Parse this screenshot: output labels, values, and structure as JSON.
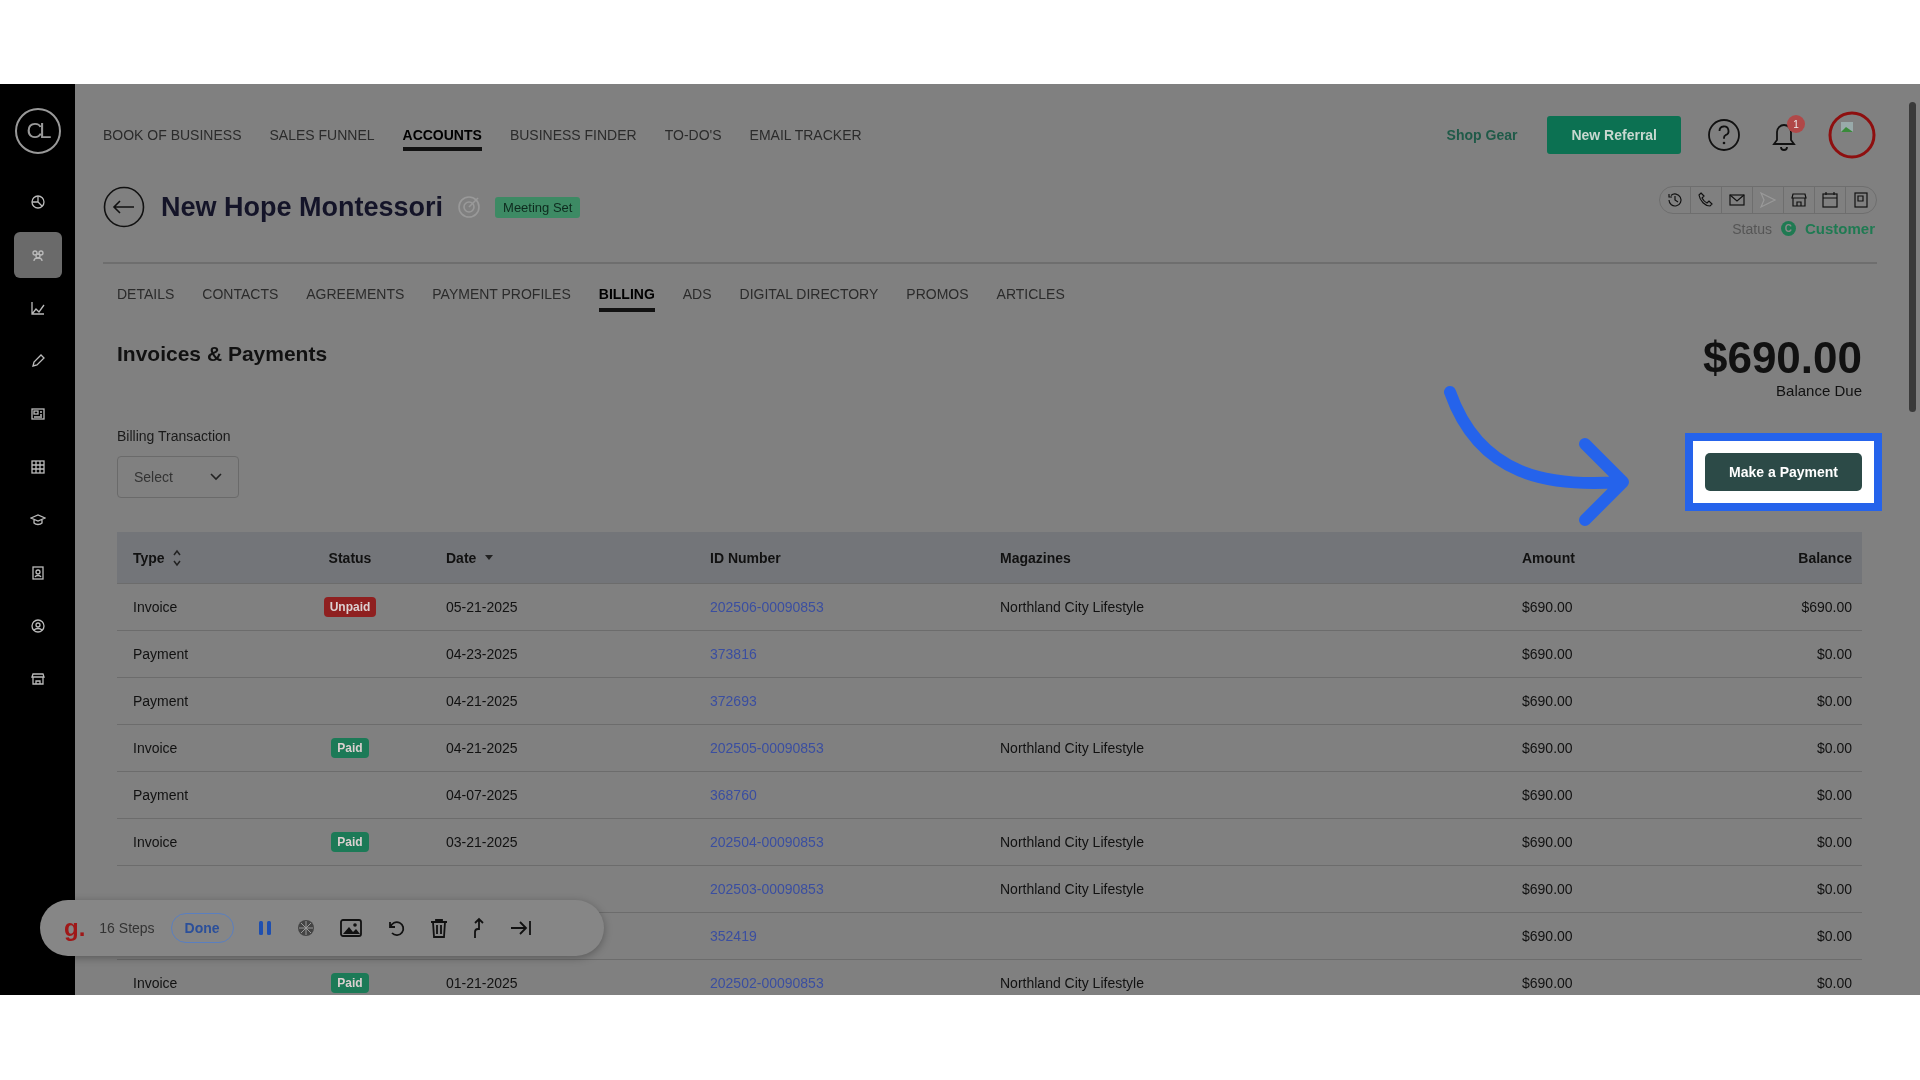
{
  "sidebar": {
    "logo": "CL",
    "items": [
      {
        "selected": false
      },
      {
        "selected": true
      },
      {
        "selected": false
      },
      {
        "selected": false
      },
      {
        "selected": false
      },
      {
        "selected": false
      },
      {
        "selected": false
      },
      {
        "selected": false
      },
      {
        "selected": false
      },
      {
        "selected": false
      }
    ]
  },
  "top_nav": {
    "items": [
      {
        "label": "BOOK OF BUSINESS",
        "selected": false
      },
      {
        "label": "SALES FUNNEL",
        "selected": false
      },
      {
        "label": "ACCOUNTS",
        "selected": true
      },
      {
        "label": "BUSINESS FINDER",
        "selected": false
      },
      {
        "label": "TO-DO'S",
        "selected": false
      },
      {
        "label": "EMAIL TRACKER",
        "selected": false
      }
    ],
    "shop_link": "Shop Gear",
    "referral_button": "New Referral",
    "notification_count": "1"
  },
  "account": {
    "name": "New Hope Montessori",
    "badge": "Meeting Set",
    "status_label": "Status",
    "status_initial": "C",
    "status_value": "Customer"
  },
  "tabs": [
    {
      "label": "DETAILS",
      "selected": false
    },
    {
      "label": "CONTACTS",
      "selected": false
    },
    {
      "label": "AGREEMENTS",
      "selected": false
    },
    {
      "label": "PAYMENT PROFILES",
      "selected": false
    },
    {
      "label": "BILLING",
      "selected": true
    },
    {
      "label": "ADS",
      "selected": false
    },
    {
      "label": "DIGITAL DIRECTORY",
      "selected": false
    },
    {
      "label": "PROMOS",
      "selected": false
    },
    {
      "label": "ARTICLES",
      "selected": false
    }
  ],
  "billing": {
    "heading": "Invoices & Payments",
    "balance": "$690.00",
    "balance_label": "Balance Due",
    "filter_label": "Billing Transaction",
    "filter_placeholder": "Select",
    "payment_button": "Make a Payment"
  },
  "table": {
    "columns": [
      "Type",
      "Status",
      "Date",
      "ID Number",
      "Magazines",
      "Amount",
      "Balance"
    ],
    "rows": [
      {
        "type": "Invoice",
        "status": {
          "label": "Unpaid",
          "color": "#8f2020"
        },
        "date": "05-21-2025",
        "id": "202506-00090853",
        "magazine": "Northland City Lifestyle",
        "amount": "$690.00",
        "balance": "$690.00"
      },
      {
        "type": "Payment",
        "date": "04-23-2025",
        "id": "373816",
        "amount": "$690.00",
        "balance": "$0.00"
      },
      {
        "type": "Payment",
        "date": "04-21-2025",
        "id": "372693",
        "amount": "$690.00",
        "balance": "$0.00"
      },
      {
        "type": "Invoice",
        "status": {
          "label": "Paid",
          "color": "#1c7a57"
        },
        "date": "04-21-2025",
        "id": "202505-00090853",
        "magazine": "Northland City Lifestyle",
        "amount": "$690.00",
        "balance": "$0.00"
      },
      {
        "type": "Payment",
        "date": "04-07-2025",
        "id": "368760",
        "amount": "$690.00",
        "balance": "$0.00"
      },
      {
        "type": "Invoice",
        "status": {
          "label": "Paid",
          "color": "#1c7a57"
        },
        "date": "03-21-2025",
        "id": "202504-00090853",
        "magazine": "Northland City Lifestyle",
        "amount": "$690.00",
        "balance": "$0.00"
      },
      {
        "id": "202503-00090853",
        "magazine": "Northland City Lifestyle",
        "amount": "$690.00",
        "balance": "$0.00"
      },
      {
        "id": "352419",
        "amount": "$690.00",
        "balance": "$0.00"
      },
      {
        "type": "Invoice",
        "status": {
          "label": "Paid",
          "color": "#1c7a57"
        },
        "date": "01-21-2025",
        "id": "202502-00090853",
        "magazine": "Northland City Lifestyle",
        "amount": "$690.00",
        "balance": "$0.00"
      }
    ]
  },
  "recorder_toolbar": {
    "logo": "g.",
    "steps": "16 Steps",
    "done_button": "Done"
  }
}
